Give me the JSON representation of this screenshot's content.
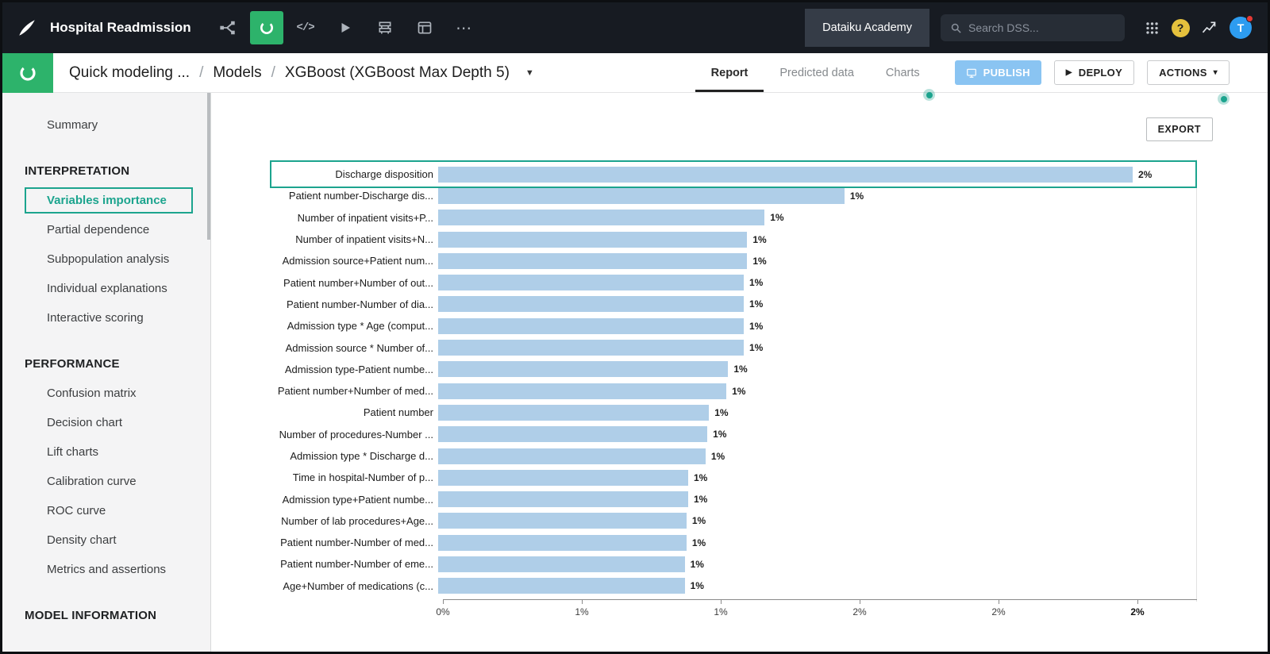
{
  "colors": {
    "accent_teal": "#1CA48E",
    "icon_green": "#2DB36B",
    "bar_fill": "#AFCEE8",
    "publish_blue": "#8AC4F2",
    "topbar_bg": "#171B22"
  },
  "topbar": {
    "project_title": "Hospital Readmission",
    "academy_label": "Dataiku Academy",
    "search_placeholder": "Search DSS...",
    "avatar_initial": "T",
    "code_icon_label": "</>",
    "more_icon_label": "⋯",
    "icons": [
      "dataiku-logo",
      "flow",
      "lab",
      "code",
      "play",
      "jobs",
      "notebook",
      "more",
      "apps-grid",
      "help",
      "trend",
      "avatar"
    ]
  },
  "header": {
    "breadcrumb": [
      "Quick modeling ...",
      "Models",
      "XGBoost (XGBoost Max Depth 5)"
    ],
    "tabs": [
      {
        "label": "Report",
        "active": true
      },
      {
        "label": "Predicted data",
        "active": false
      },
      {
        "label": "Charts",
        "active": false
      }
    ],
    "publish_label": "PUBLISH",
    "deploy_label": "DEPLOY",
    "actions_label": "ACTIONS"
  },
  "sidebar": {
    "sections": [
      {
        "header": null,
        "items": [
          {
            "label": "Summary",
            "active": false
          }
        ]
      },
      {
        "header": "INTERPRETATION",
        "items": [
          {
            "label": "Variables importance",
            "active": true
          },
          {
            "label": "Partial dependence",
            "active": false
          },
          {
            "label": "Subpopulation analysis",
            "active": false
          },
          {
            "label": "Individual explanations",
            "active": false
          },
          {
            "label": "Interactive scoring",
            "active": false
          }
        ]
      },
      {
        "header": "PERFORMANCE",
        "items": [
          {
            "label": "Confusion matrix",
            "active": false
          },
          {
            "label": "Decision chart",
            "active": false
          },
          {
            "label": "Lift charts",
            "active": false
          },
          {
            "label": "Calibration curve",
            "active": false
          },
          {
            "label": "ROC curve",
            "active": false
          },
          {
            "label": "Density chart",
            "active": false
          },
          {
            "label": "Metrics and assertions",
            "active": false
          }
        ]
      },
      {
        "header": "MODEL INFORMATION",
        "items": []
      }
    ]
  },
  "main": {
    "export_label": "EXPORT"
  },
  "chart_data": {
    "type": "bar",
    "orientation": "horizontal",
    "title": "",
    "xlabel": "",
    "ylabel": "",
    "unit": "%",
    "xlim": [
      0,
      2.0
    ],
    "grid": false,
    "highlighted_index": 0,
    "categories": [
      "Discharge disposition",
      "Patient number-Discharge dis...",
      "Number of inpatient visits+P...",
      "Number of inpatient visits+N...",
      "Admission source+Patient num...",
      "Patient number+Number of out...",
      "Patient number-Number of dia...",
      "Admission type * Age (comput...",
      "Admission source * Number of...",
      "Admission type-Patient numbe...",
      "Patient number+Number of med...",
      "Patient number",
      "Number of procedures-Number ...",
      "Admission type * Discharge d...",
      "Time in hospital-Number of p...",
      "Admission type+Patient numbe...",
      "Number of lab procedures+Age...",
      "Patient number-Number of med...",
      "Patient number-Number of eme...",
      "Age+Number of medications (c..."
    ],
    "values": [
      2.0,
      1.17,
      0.94,
      0.89,
      0.89,
      0.88,
      0.88,
      0.88,
      0.88,
      0.835,
      0.83,
      0.78,
      0.775,
      0.77,
      0.72,
      0.72,
      0.715,
      0.715,
      0.71,
      0.71
    ],
    "value_labels": [
      "2%",
      "1%",
      "1%",
      "1%",
      "1%",
      "1%",
      "1%",
      "1%",
      "1%",
      "1%",
      "1%",
      "1%",
      "1%",
      "1%",
      "1%",
      "1%",
      "1%",
      "1%",
      "1%",
      "1%"
    ],
    "x_ticks": [
      "0%",
      "1%",
      "1%",
      "2%",
      "2%",
      "2%"
    ]
  }
}
